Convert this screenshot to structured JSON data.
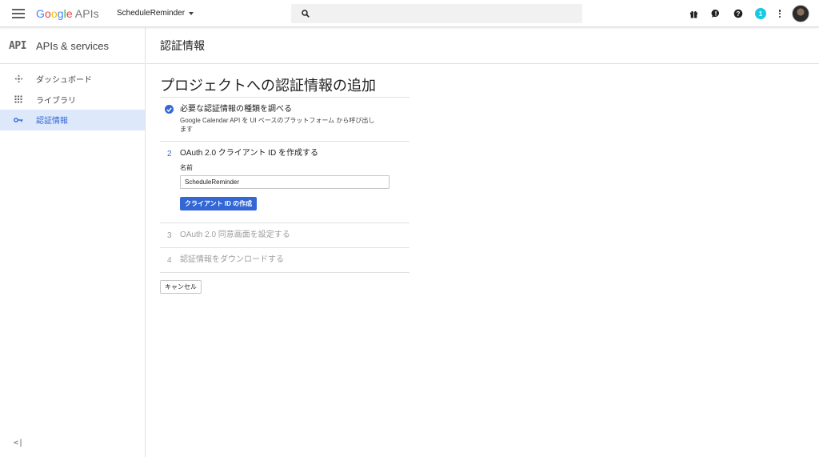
{
  "header": {
    "logo_parts": [
      "G",
      "o",
      "o",
      "g",
      "l",
      "e"
    ],
    "logo_suffix": "APIs",
    "project_name": "ScheduleReminder",
    "search_placeholder": "",
    "notification_count": "1",
    "icons": [
      "menu-icon",
      "gift-icon",
      "feedback-icon",
      "help-icon",
      "more-vert-icon"
    ]
  },
  "sidebar": {
    "logo": "API",
    "title": "APIs & services",
    "items": [
      {
        "label": "ダッシュボード",
        "icon": "dashboard-icon",
        "active": false
      },
      {
        "label": "ライブラリ",
        "icon": "library-icon",
        "active": false
      },
      {
        "label": "認証情報",
        "icon": "key-icon",
        "active": true
      }
    ],
    "collapse_label": "<|"
  },
  "page": {
    "header_title": "認証情報",
    "heading": "プロジェクトへの認証情報の追加",
    "steps": [
      {
        "number": "",
        "state": "done",
        "title": "必要な認証情報の種類を調べる",
        "description": "Google Calendar API を UI ベースのプラットフォーム から呼び出します"
      },
      {
        "number": "2",
        "state": "active",
        "title": "OAuth 2.0 クライアント ID を作成する",
        "field_label": "名前",
        "field_value": "ScheduleReminder",
        "button_label": "クライアント ID の作成"
      },
      {
        "number": "3",
        "state": "disabled",
        "title": "OAuth 2.0 同意画面を設定する"
      },
      {
        "number": "4",
        "state": "disabled",
        "title": "認証情報をダウンロードする"
      }
    ],
    "cancel_label": "キャンセル"
  },
  "colors": {
    "accent": "#3367d6",
    "active_nav_bg": "#dde8fb",
    "badge": "#18c9e4"
  }
}
